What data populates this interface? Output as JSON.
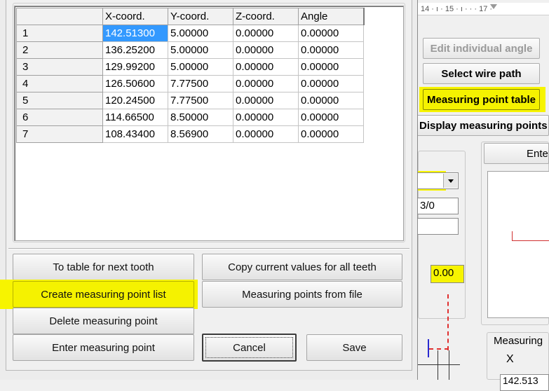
{
  "grid": {
    "columns": [
      "X-coord.",
      "Y-coord.",
      "Z-coord.",
      "Angle"
    ],
    "rows": [
      {
        "label": "1",
        "x": "142.51300",
        "y": "5.00000",
        "z": "0.00000",
        "angle": "0.00000"
      },
      {
        "label": "2",
        "x": "136.25200",
        "y": "5.00000",
        "z": "0.00000",
        "angle": "0.00000"
      },
      {
        "label": "3",
        "x": "129.99200",
        "y": "5.00000",
        "z": "0.00000",
        "angle": "0.00000"
      },
      {
        "label": "4",
        "x": "126.50600",
        "y": "7.77500",
        "z": "0.00000",
        "angle": "0.00000"
      },
      {
        "label": "5",
        "x": "120.24500",
        "y": "7.77500",
        "z": "0.00000",
        "angle": "0.00000"
      },
      {
        "label": "6",
        "x": "114.66500",
        "y": "8.50000",
        "z": "0.00000",
        "angle": "0.00000"
      },
      {
        "label": "7",
        "x": "108.43400",
        "y": "8.56900",
        "z": "0.00000",
        "angle": "0.00000"
      }
    ],
    "selected_cell": "142.51300"
  },
  "buttons": {
    "to_table_next_tooth": "To table for next tooth",
    "create_measuring_point_list": "Create measuring point list",
    "delete_measuring_point": "Delete measuring point",
    "enter_measuring_point": "Enter measuring point",
    "copy_current_values": "Copy current values for all teeth",
    "measuring_points_from_file": "Measuring points from file",
    "cancel": "Cancel",
    "save": "Save"
  },
  "background_app": {
    "ruler": "14 · ı · 15 · ı · · · 17 ·",
    "edit_individual_angle": "Edit individual angle",
    "select_wire_path": "Select wire path",
    "measuring_point_table": "Measuring point table",
    "display_measuring_points": "Display measuring points",
    "enter_button": "Ente",
    "field_value": "3/0",
    "angle_value": "0.00",
    "measuring_group_label": "Measuring",
    "x_label": "X",
    "x_value": "142.513"
  },
  "colors": {
    "highlight": "#f7f400",
    "selection": "#3399ff",
    "dashed_red": "#e03030"
  }
}
